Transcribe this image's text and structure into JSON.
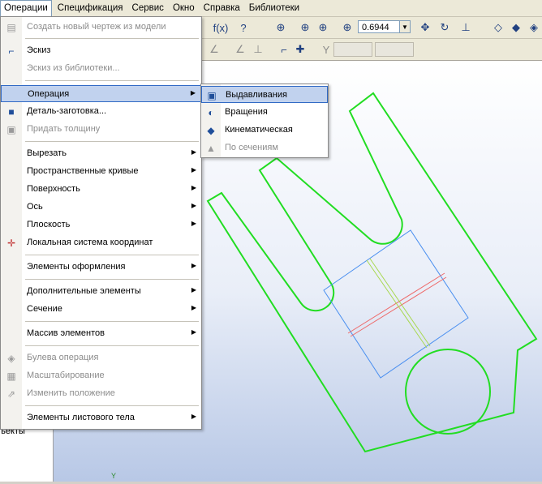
{
  "menubar": {
    "items": [
      "Операции",
      "Спецификация",
      "Сервис",
      "Окно",
      "Справка",
      "Библиотеки"
    ],
    "active": "Операции"
  },
  "toolbar": {
    "zoom_value": "0.6944",
    "icons": [
      "fx-icon",
      "help-pointer-icon",
      "zoom-icon",
      "zoom-window-icon",
      "zoom-region-icon",
      "zoom-in-icon",
      "pan-icon",
      "rotate-icon",
      "orientation-icon",
      "view-cube-icon",
      "shaded-view-icon",
      "shaded-edges-view-icon"
    ]
  },
  "tree": {
    "visible_text": "ъекты"
  },
  "operations_menu": {
    "items": [
      {
        "label": "Создать новый чертеж из модели",
        "disabled": true,
        "icon": "drawing-icon"
      },
      {
        "label": "Эскиз",
        "disabled": false,
        "icon": "sketch-icon"
      },
      {
        "label": "Эскиз из библиотеки...",
        "disabled": true,
        "icon": ""
      },
      {
        "label": "Операция",
        "disabled": false,
        "icon": "",
        "submenu": true,
        "highlight": true
      },
      {
        "label": "Деталь-заготовка...",
        "disabled": false,
        "icon": "part-icon"
      },
      {
        "label": "Придать толщину",
        "disabled": true,
        "icon": "thickness-icon"
      },
      {
        "label": "Вырезать",
        "disabled": false,
        "icon": "",
        "submenu": true
      },
      {
        "label": "Пространственные кривые",
        "disabled": false,
        "icon": "",
        "submenu": true
      },
      {
        "label": "Поверхность",
        "disabled": false,
        "icon": "",
        "submenu": true
      },
      {
        "label": "Ось",
        "disabled": false,
        "icon": "",
        "submenu": true
      },
      {
        "label": "Плоскость",
        "disabled": false,
        "icon": "",
        "submenu": true
      },
      {
        "label": "Локальная система координат",
        "disabled": false,
        "icon": "local-coordinate-icon"
      },
      {
        "label": "Элементы оформления",
        "disabled": false,
        "icon": "",
        "submenu": true
      },
      {
        "label": "Дополнительные элементы",
        "disabled": false,
        "icon": "",
        "submenu": true
      },
      {
        "label": "Сечение",
        "disabled": false,
        "icon": "",
        "submenu": true
      },
      {
        "label": "Массив элементов",
        "disabled": false,
        "icon": "",
        "submenu": true
      },
      {
        "label": "Булева операция",
        "disabled": true,
        "icon": "boolean-icon"
      },
      {
        "label": "Масштабирование",
        "disabled": true,
        "icon": "scale-icon"
      },
      {
        "label": "Изменить положение",
        "disabled": true,
        "icon": "move-icon"
      },
      {
        "label": "Элементы листового тела",
        "disabled": false,
        "icon": "",
        "submenu": true
      }
    ]
  },
  "operation_submenu": {
    "items": [
      {
        "label": "Выдавливания",
        "disabled": false,
        "icon": "extrude-icon",
        "highlight": true
      },
      {
        "label": "Вращения",
        "disabled": false,
        "icon": "revolve-icon"
      },
      {
        "label": "Кинематическая",
        "disabled": false,
        "icon": "sweep-icon"
      },
      {
        "label": "По сечениям",
        "disabled": true,
        "icon": "loft-icon"
      }
    ]
  },
  "viewport": {
    "axis_label": "Y",
    "colors": {
      "sketch": "#22dd22",
      "plane": "#4a8ff0",
      "axis_red": "#ee6a6a",
      "axis_green": "#a8d850"
    }
  }
}
